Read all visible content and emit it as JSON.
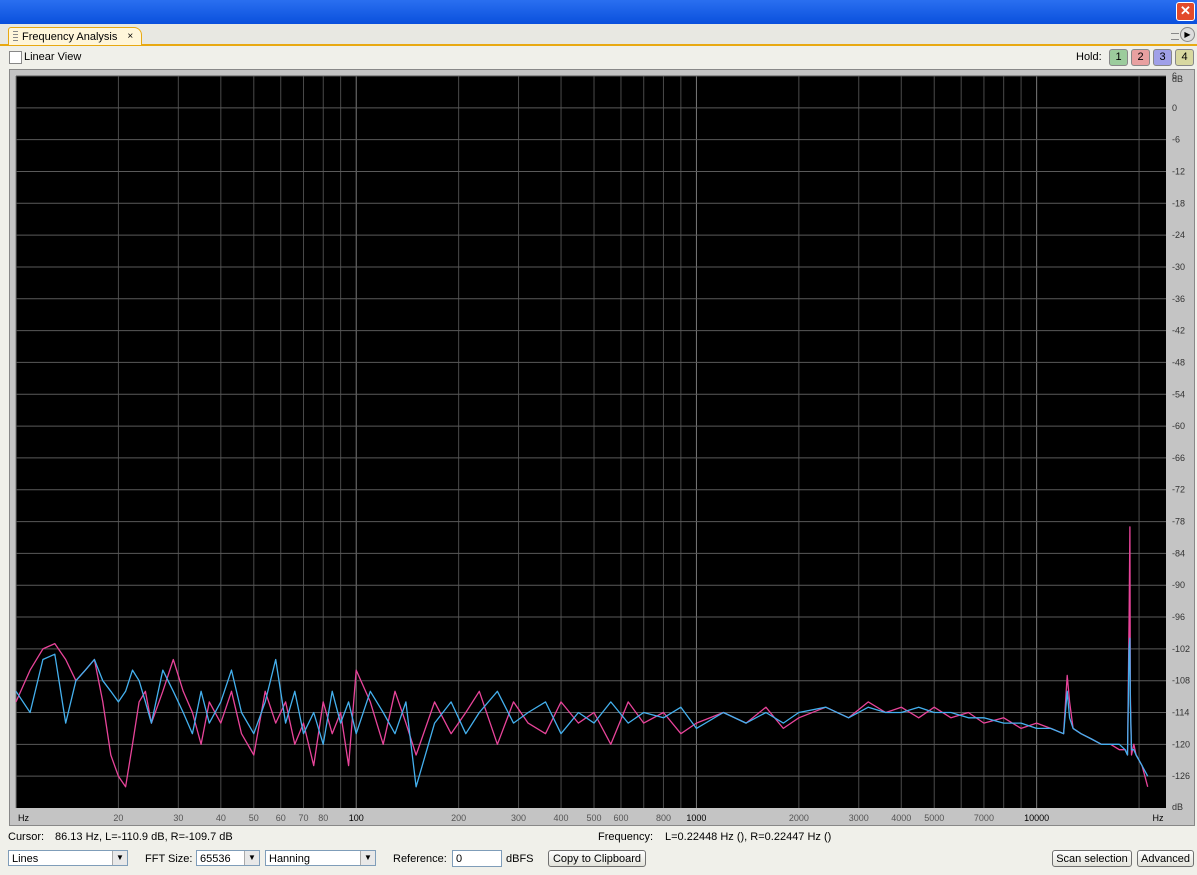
{
  "window": {
    "close_glyph": "✕"
  },
  "tab": {
    "label": "Frequency Analysis",
    "close_glyph": "×",
    "arrow_glyph": "▶"
  },
  "options": {
    "linear_view_label": "Linear View",
    "hold_label": "Hold:",
    "hold_buttons": [
      "1",
      "2",
      "3",
      "4"
    ],
    "hold_colors": [
      "#9ccc9c",
      "#e8a0a0",
      "#a0a0e8",
      "#d8d8a0"
    ]
  },
  "status": {
    "cursor_label": "Cursor:",
    "cursor_value": "86.13 Hz, L=-110.9 dB, R=-109.7 dB",
    "frequency_label": "Frequency:",
    "frequency_value": "L=0.22448 Hz (), R=0.22447 Hz ()"
  },
  "controls": {
    "display_mode": "Lines",
    "fft_size_label": "FFT Size:",
    "fft_size": "65536",
    "window": "Hanning",
    "reference_label": "Reference:",
    "reference_value": "0",
    "reference_unit": "dBFS",
    "copy_button": "Copy to Clipboard",
    "scan_button": "Scan selection",
    "advanced_button": "Advanced"
  },
  "chart_data": {
    "type": "line",
    "x_scale": "log",
    "xlim": [
      10,
      24000
    ],
    "ylim": [
      -132,
      6
    ],
    "x_ticks": [
      20,
      30,
      40,
      50,
      60,
      70,
      80,
      100,
      200,
      300,
      400,
      500,
      600,
      800,
      1000,
      2000,
      3000,
      4000,
      5000,
      7000,
      10000
    ],
    "x_tick_labels": [
      "20",
      "30",
      "40",
      "50",
      "60",
      "70",
      "80",
      "100",
      "200",
      "300",
      "400",
      "500",
      "600",
      "800",
      "1000",
      "2000",
      "3000",
      "4000",
      "5000",
      "7000",
      "10000"
    ],
    "x_unit_left": "Hz",
    "x_unit_right": "Hz",
    "y_ticks": [
      6,
      0,
      -6,
      -12,
      -18,
      -24,
      -30,
      -36,
      -42,
      -48,
      -54,
      -60,
      -66,
      -72,
      -78,
      -84,
      -90,
      -96,
      -102,
      -108,
      -114,
      -120,
      -126
    ],
    "y_tick_labels": [
      "6",
      "0",
      "-6",
      "-12",
      "-18",
      "-24",
      "-30",
      "-36",
      "-42",
      "-48",
      "-54",
      "-60",
      "-66",
      "-72",
      "-78",
      "-84",
      "-90",
      "-96",
      "-102",
      "-108",
      "-114",
      "-120",
      "-126"
    ],
    "y_unit_top": "dB",
    "y_unit_bottom": "dB",
    "grid": true,
    "series": [
      {
        "color": "#e8449a",
        "x": [
          10,
          11,
          12,
          13,
          14,
          15,
          16,
          17,
          18,
          19,
          20,
          21,
          22,
          23,
          24,
          25,
          27,
          29,
          31,
          33,
          35,
          37,
          40,
          43,
          46,
          50,
          54,
          58,
          62,
          66,
          70,
          75,
          80,
          85,
          90,
          95,
          100,
          110,
          120,
          130,
          140,
          150,
          170,
          190,
          210,
          230,
          260,
          290,
          320,
          360,
          400,
          450,
          500,
          560,
          630,
          700,
          800,
          900,
          1000,
          1200,
          1400,
          1600,
          1800,
          2000,
          2400,
          2800,
          3200,
          3600,
          4000,
          4500,
          5000,
          5600,
          6300,
          7000,
          8000,
          9000,
          10000,
          11000,
          12000,
          12300,
          12500,
          12800,
          13500,
          14500,
          15500,
          16500,
          17500,
          18200,
          18500,
          18700,
          18800,
          18850,
          19000,
          19300,
          19600,
          20000,
          20400,
          20800,
          21200
        ],
        "y": [
          -112,
          -106,
          -102,
          -101,
          -104,
          -108,
          -106,
          -104,
          -112,
          -122,
          -126,
          -128,
          -120,
          -112,
          -110,
          -116,
          -110,
          -104,
          -110,
          -114,
          -120,
          -112,
          -116,
          -110,
          -118,
          -122,
          -110,
          -116,
          -112,
          -120,
          -116,
          -124,
          -112,
          -118,
          -114,
          -124,
          -106,
          -112,
          -120,
          -110,
          -116,
          -122,
          -112,
          -118,
          -114,
          -110,
          -120,
          -112,
          -116,
          -118,
          -112,
          -116,
          -114,
          -120,
          -112,
          -116,
          -114,
          -118,
          -116,
          -114,
          -116,
          -113,
          -117,
          -115,
          -113,
          -115,
          -112,
          -114,
          -113,
          -115,
          -113,
          -115,
          -114,
          -116,
          -115,
          -117,
          -116,
          -117,
          -118,
          -107,
          -112,
          -117,
          -118,
          -119,
          -120,
          -120,
          -121,
          -121,
          -122,
          -96,
          -79,
          -110,
          -122,
          -120,
          -122,
          -123,
          -124,
          -126,
          -128
        ]
      },
      {
        "color": "#44b0ee",
        "x": [
          10,
          11,
          12,
          13,
          14,
          15,
          16,
          17,
          18,
          19,
          20,
          21,
          22,
          23,
          24,
          25,
          27,
          29,
          31,
          33,
          35,
          37,
          40,
          43,
          46,
          50,
          54,
          58,
          62,
          66,
          70,
          75,
          80,
          85,
          90,
          95,
          100,
          110,
          120,
          130,
          140,
          150,
          170,
          190,
          210,
          230,
          260,
          290,
          320,
          360,
          400,
          450,
          500,
          560,
          630,
          700,
          800,
          900,
          1000,
          1200,
          1400,
          1600,
          1800,
          2000,
          2400,
          2800,
          3200,
          3600,
          4000,
          4500,
          5000,
          5600,
          6300,
          7000,
          8000,
          9000,
          10000,
          11000,
          12000,
          12300,
          12500,
          12800,
          13500,
          14500,
          15500,
          16500,
          17500,
          18200,
          18500,
          18700,
          18800,
          18850,
          19000,
          19300,
          19600,
          20000,
          20400,
          20800,
          21200
        ],
        "y": [
          -110,
          -114,
          -104,
          -103,
          -116,
          -108,
          -106,
          -104,
          -108,
          -110,
          -112,
          -110,
          -106,
          -108,
          -112,
          -116,
          -106,
          -110,
          -114,
          -118,
          -110,
          -116,
          -112,
          -106,
          -114,
          -118,
          -112,
          -104,
          -116,
          -110,
          -118,
          -114,
          -120,
          -110,
          -116,
          -112,
          -118,
          -110,
          -114,
          -118,
          -112,
          -128,
          -116,
          -112,
          -118,
          -114,
          -110,
          -116,
          -114,
          -112,
          -118,
          -114,
          -116,
          -112,
          -116,
          -114,
          -115,
          -113,
          -117,
          -114,
          -116,
          -114,
          -116,
          -114,
          -113,
          -115,
          -113,
          -114,
          -114,
          -113,
          -114,
          -114,
          -115,
          -115,
          -116,
          -116,
          -117,
          -117,
          -118,
          -110,
          -115,
          -117,
          -118,
          -119,
          -120,
          -120,
          -120,
          -121,
          -122,
          -102,
          -100,
          -112,
          -121,
          -121,
          -122,
          -123,
          -124,
          -125,
          -126
        ]
      }
    ]
  }
}
